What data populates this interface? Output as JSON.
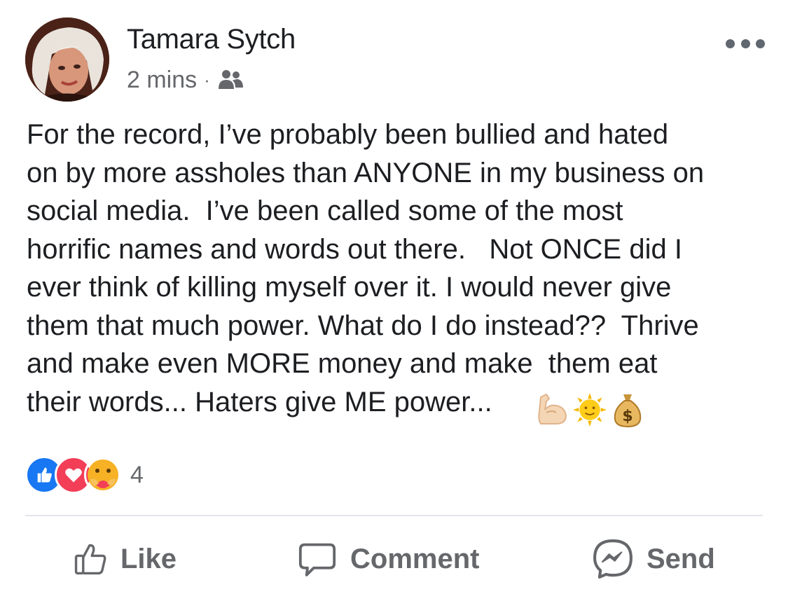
{
  "post": {
    "author": "Tamara Sytch",
    "time": "2 mins",
    "separator": "·",
    "audience_icon": "friends-icon",
    "more_icon": "more-options-icon",
    "text": "For the record, I’ve probably been bullied and hated\non by more assholes than ANYONE in my business on\nsocial media.  I’ve been called some of the most\nhorrific names and words out there.   Not ONCE did I\never think of killing myself over it. I would never give\nthem that much power. What do I do instead??  Thrive\nand make even MORE money and make  them eat\ntheir words... Haters give ME power...",
    "emojis": [
      "flexed-biceps",
      "sun-with-face",
      "money-bag"
    ]
  },
  "reactions": {
    "icons": [
      "like",
      "love",
      "care"
    ],
    "count": "4"
  },
  "actions": {
    "like_label": "Like",
    "comment_label": "Comment",
    "send_label": "Send"
  },
  "colors": {
    "text": "#1c1e21",
    "secondary": "#65676b",
    "like_blue": "#1877f2",
    "love_red": "#f33e58",
    "divider": "#e4e6eb"
  }
}
